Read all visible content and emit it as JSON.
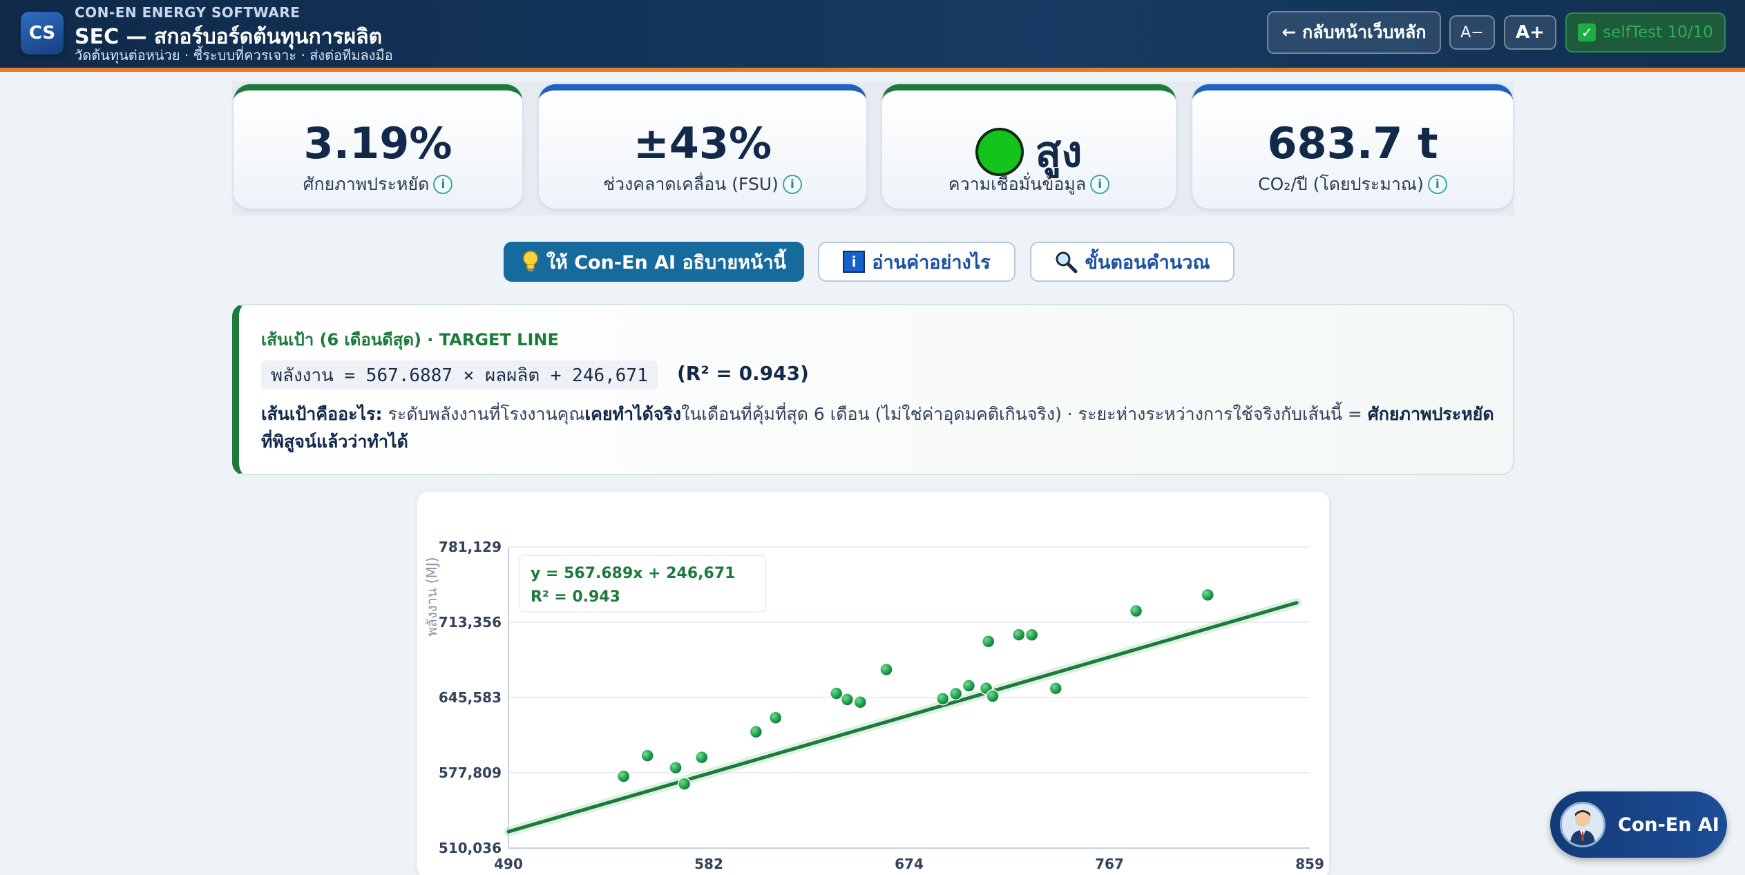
{
  "header": {
    "logo": "CS",
    "brand_sub": "CON-EN ENERGY SOFTWARE",
    "title": "SEC — สกอร์บอร์ดต้นทุนการผลิต",
    "tagline": "วัดต้นทุนต่อหน่วย · ชี้ระบบที่ควรเจาะ · ส่งต่อทีมลงมือ",
    "home_button": "← กลับหน้าเว็บหลัก",
    "font_minus": "A−",
    "font_plus": "A+",
    "selftest": "selfTest 10/10"
  },
  "kpis": [
    {
      "value": "3.19%",
      "label": "ศักยภาพประหยัด"
    },
    {
      "value": "±43%",
      "label": "ช่วงคลาดเคลื่อน (FSU)"
    },
    {
      "value": "สูง",
      "label": "ความเชื่อมั่นข้อมูล",
      "status_color": "#14c41b"
    },
    {
      "value": "683.7 t",
      "label": "CO₂/ปี (โดยประมาณ)"
    }
  ],
  "actions": {
    "ai_explain": "ให้ Con-En AI อธิบายหน้านี้",
    "how_to_read": "อ่านค่าอย่างไร",
    "calc_steps": "ขั้นตอนคำนวณ"
  },
  "target": {
    "heading": "เส้นเป้า (6 เดือนดีสุด) · TARGET LINE",
    "equation": "พลังงาน = 567.6887 × ผลผลิต + 246,671",
    "r2": "(R² = 0.943)",
    "desc_lead": "เส้นเป้าคืออะไร:",
    "desc_1": " ระดับพลังงานที่โรงงานคุณ",
    "desc_bold_1": "เคยทำได้จริง",
    "desc_2": "ในเดือนที่คุ้มที่สุด 6 เดือน (ไม่ใช่ค่าอุดมคติเกินจริง) · ระยะห่างระหว่างการใช้จริงกับเส้นนี้ = ",
    "desc_bold_2": "ศักยภาพประหยัดที่พิสูจน์แล้วว่าทำได้"
  },
  "chart_data": {
    "type": "scatter",
    "ylabel": "พลังงาน (MJ)",
    "x_ticks": [
      "490",
      "582",
      "674",
      "767",
      "859"
    ],
    "y_ticks": [
      "510,036",
      "577,809",
      "645,583",
      "713,356",
      "781,129"
    ],
    "xlim": [
      490,
      859
    ],
    "ylim": [
      510036,
      781129
    ],
    "annotation_eq": "y = 567.689x + 246,671",
    "annotation_r2": "R² = 0.943",
    "fit": {
      "slope": 567.689,
      "intercept": 246671
    },
    "colors": {
      "points": "#22a050",
      "line": "#1c7a3c"
    },
    "points": [
      [
        543,
        574700
      ],
      [
        554,
        593300
      ],
      [
        567,
        582400
      ],
      [
        571,
        567800
      ],
      [
        579,
        591700
      ],
      [
        604,
        614700
      ],
      [
        613,
        627400
      ],
      [
        641,
        649300
      ],
      [
        646,
        643800
      ],
      [
        652,
        641400
      ],
      [
        664,
        670800
      ],
      [
        690,
        644500
      ],
      [
        696,
        649000
      ],
      [
        702,
        656200
      ],
      [
        710,
        653900
      ],
      [
        711,
        696100
      ],
      [
        713,
        646900
      ],
      [
        725,
        702100
      ],
      [
        731,
        702000
      ],
      [
        742,
        653800
      ],
      [
        779,
        723500
      ],
      [
        812,
        738000
      ]
    ]
  },
  "fab": {
    "label": "Con-En AI"
  }
}
